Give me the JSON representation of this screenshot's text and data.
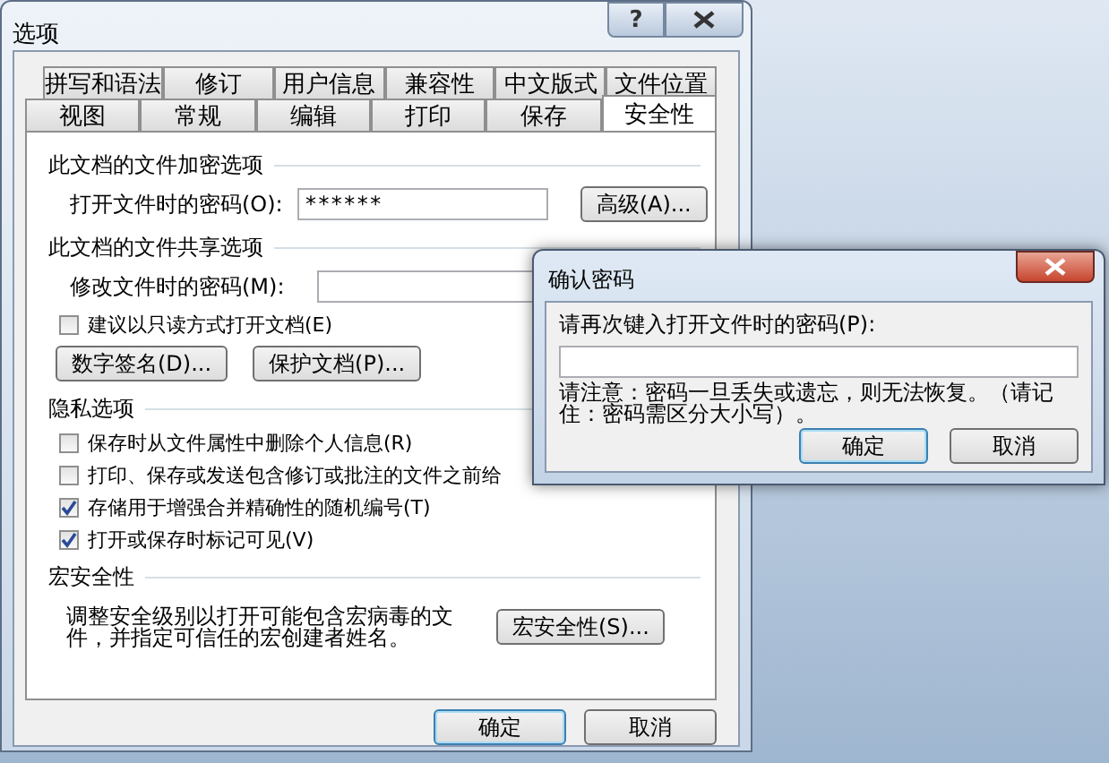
{
  "window": {
    "title": "选项",
    "help_button": "?"
  },
  "tab_rows": [
    [
      {
        "label": "拼写和语法",
        "selected": false
      },
      {
        "label": "修订",
        "selected": false
      },
      {
        "label": "用户信息",
        "selected": false
      },
      {
        "label": "兼容性",
        "selected": false
      },
      {
        "label": "中文版式",
        "selected": false
      },
      {
        "label": "文件位置",
        "selected": false
      }
    ],
    [
      {
        "label": "视图",
        "selected": false
      },
      {
        "label": "常规",
        "selected": false
      },
      {
        "label": "编辑",
        "selected": false
      },
      {
        "label": "打印",
        "selected": false
      },
      {
        "label": "保存",
        "selected": false
      },
      {
        "label": "安全性",
        "selected": true
      }
    ]
  ],
  "sections": [
    {
      "title": "此文档的文件加密选项",
      "items": [
        {
          "kind": "field",
          "label": "打开文件时的密码(O):",
          "value": "******",
          "button": "高级(A)..."
        }
      ]
    },
    {
      "title": "此文档的文件共享选项",
      "items": [
        {
          "kind": "field",
          "label": "修改文件时的密码(M):"
        },
        {
          "kind": "checkbox",
          "label": "建议以只读方式打开文档(E)",
          "checked": false
        },
        {
          "kind": "buttons",
          "buttons": [
            "数字签名(D)...",
            "保护文档(P)..."
          ]
        }
      ]
    },
    {
      "title": "隐私选项",
      "items": [
        {
          "kind": "checkbox",
          "label": "保存时从文件属性中删除个人信息(R)",
          "checked": false
        },
        {
          "kind": "checkbox",
          "label": "打印、保存或发送包含修订或批注的文件之前给",
          "checked": false
        },
        {
          "kind": "checkbox",
          "label": "存储用于增强合并精确性的随机编号(T)",
          "checked": true
        },
        {
          "kind": "checkbox",
          "label": "打开或保存时标记可见(V)",
          "checked": true
        }
      ]
    },
    {
      "title": "宏安全性",
      "items": [
        {
          "kind": "text_button",
          "text": "调整安全级别以打开可能包含宏病毒的文件，并指定可信任的宏创建者姓名。",
          "button": "宏安全性(S)..."
        }
      ]
    }
  ],
  "footer_buttons": [
    {
      "label": "确定",
      "default": true
    },
    {
      "label": "取消",
      "default": false
    }
  ],
  "confirm_dialog": {
    "title": "确认密码",
    "prompt": "请再次键入打开文件时的密码(P):",
    "note": "请注意：密码一旦丢失或遗忘，则无法恢复。（请记住：密码需区分大小写）。",
    "buttons": [
      {
        "label": "确定",
        "default": true
      },
      {
        "label": "取消",
        "default": false
      }
    ]
  }
}
